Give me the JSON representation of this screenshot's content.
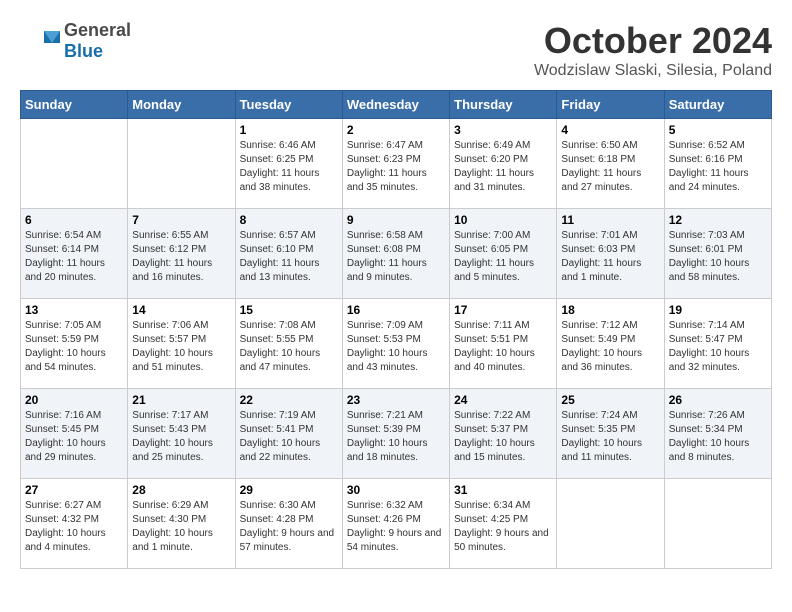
{
  "logo": {
    "general": "General",
    "blue": "Blue"
  },
  "title": "October 2024",
  "location": "Wodzislaw Slaski, Silesia, Poland",
  "days_of_week": [
    "Sunday",
    "Monday",
    "Tuesday",
    "Wednesday",
    "Thursday",
    "Friday",
    "Saturday"
  ],
  "weeks": [
    [
      {
        "day": "",
        "info": ""
      },
      {
        "day": "",
        "info": ""
      },
      {
        "day": "1",
        "info": "Sunrise: 6:46 AM\nSunset: 6:25 PM\nDaylight: 11 hours\nand 38 minutes."
      },
      {
        "day": "2",
        "info": "Sunrise: 6:47 AM\nSunset: 6:23 PM\nDaylight: 11 hours\nand 35 minutes."
      },
      {
        "day": "3",
        "info": "Sunrise: 6:49 AM\nSunset: 6:20 PM\nDaylight: 11 hours\nand 31 minutes."
      },
      {
        "day": "4",
        "info": "Sunrise: 6:50 AM\nSunset: 6:18 PM\nDaylight: 11 hours\nand 27 minutes."
      },
      {
        "day": "5",
        "info": "Sunrise: 6:52 AM\nSunset: 6:16 PM\nDaylight: 11 hours\nand 24 minutes."
      }
    ],
    [
      {
        "day": "6",
        "info": "Sunrise: 6:54 AM\nSunset: 6:14 PM\nDaylight: 11 hours\nand 20 minutes."
      },
      {
        "day": "7",
        "info": "Sunrise: 6:55 AM\nSunset: 6:12 PM\nDaylight: 11 hours\nand 16 minutes."
      },
      {
        "day": "8",
        "info": "Sunrise: 6:57 AM\nSunset: 6:10 PM\nDaylight: 11 hours\nand 13 minutes."
      },
      {
        "day": "9",
        "info": "Sunrise: 6:58 AM\nSunset: 6:08 PM\nDaylight: 11 hours\nand 9 minutes."
      },
      {
        "day": "10",
        "info": "Sunrise: 7:00 AM\nSunset: 6:05 PM\nDaylight: 11 hours\nand 5 minutes."
      },
      {
        "day": "11",
        "info": "Sunrise: 7:01 AM\nSunset: 6:03 PM\nDaylight: 11 hours\nand 1 minute."
      },
      {
        "day": "12",
        "info": "Sunrise: 7:03 AM\nSunset: 6:01 PM\nDaylight: 10 hours\nand 58 minutes."
      }
    ],
    [
      {
        "day": "13",
        "info": "Sunrise: 7:05 AM\nSunset: 5:59 PM\nDaylight: 10 hours\nand 54 minutes."
      },
      {
        "day": "14",
        "info": "Sunrise: 7:06 AM\nSunset: 5:57 PM\nDaylight: 10 hours\nand 51 minutes."
      },
      {
        "day": "15",
        "info": "Sunrise: 7:08 AM\nSunset: 5:55 PM\nDaylight: 10 hours\nand 47 minutes."
      },
      {
        "day": "16",
        "info": "Sunrise: 7:09 AM\nSunset: 5:53 PM\nDaylight: 10 hours\nand 43 minutes."
      },
      {
        "day": "17",
        "info": "Sunrise: 7:11 AM\nSunset: 5:51 PM\nDaylight: 10 hours\nand 40 minutes."
      },
      {
        "day": "18",
        "info": "Sunrise: 7:12 AM\nSunset: 5:49 PM\nDaylight: 10 hours\nand 36 minutes."
      },
      {
        "day": "19",
        "info": "Sunrise: 7:14 AM\nSunset: 5:47 PM\nDaylight: 10 hours\nand 32 minutes."
      }
    ],
    [
      {
        "day": "20",
        "info": "Sunrise: 7:16 AM\nSunset: 5:45 PM\nDaylight: 10 hours\nand 29 minutes."
      },
      {
        "day": "21",
        "info": "Sunrise: 7:17 AM\nSunset: 5:43 PM\nDaylight: 10 hours\nand 25 minutes."
      },
      {
        "day": "22",
        "info": "Sunrise: 7:19 AM\nSunset: 5:41 PM\nDaylight: 10 hours\nand 22 minutes."
      },
      {
        "day": "23",
        "info": "Sunrise: 7:21 AM\nSunset: 5:39 PM\nDaylight: 10 hours\nand 18 minutes."
      },
      {
        "day": "24",
        "info": "Sunrise: 7:22 AM\nSunset: 5:37 PM\nDaylight: 10 hours\nand 15 minutes."
      },
      {
        "day": "25",
        "info": "Sunrise: 7:24 AM\nSunset: 5:35 PM\nDaylight: 10 hours\nand 11 minutes."
      },
      {
        "day": "26",
        "info": "Sunrise: 7:26 AM\nSunset: 5:34 PM\nDaylight: 10 hours\nand 8 minutes."
      }
    ],
    [
      {
        "day": "27",
        "info": "Sunrise: 6:27 AM\nSunset: 4:32 PM\nDaylight: 10 hours\nand 4 minutes."
      },
      {
        "day": "28",
        "info": "Sunrise: 6:29 AM\nSunset: 4:30 PM\nDaylight: 10 hours\nand 1 minute."
      },
      {
        "day": "29",
        "info": "Sunrise: 6:30 AM\nSunset: 4:28 PM\nDaylight: 9 hours\nand 57 minutes."
      },
      {
        "day": "30",
        "info": "Sunrise: 6:32 AM\nSunset: 4:26 PM\nDaylight: 9 hours\nand 54 minutes."
      },
      {
        "day": "31",
        "info": "Sunrise: 6:34 AM\nSunset: 4:25 PM\nDaylight: 9 hours\nand 50 minutes."
      },
      {
        "day": "",
        "info": ""
      },
      {
        "day": "",
        "info": ""
      }
    ]
  ]
}
